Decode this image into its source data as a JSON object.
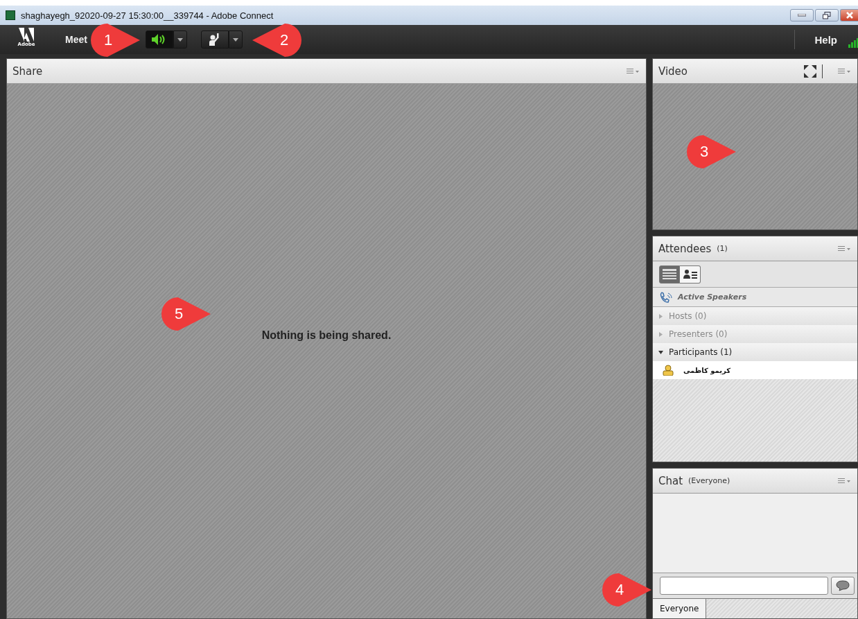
{
  "window": {
    "title": "shaghayegh_92020-09-27 15:30:00__339744 - Adobe Connect"
  },
  "menu_bar": {
    "logo": "Adobe",
    "menu": "Meet",
    "audio": {
      "on": true
    },
    "help": "Help"
  },
  "share_pod": {
    "title": "Share",
    "message": "Nothing is being shared."
  },
  "video_pod": {
    "title": "Video"
  },
  "attendees_pod": {
    "title": "Attendees",
    "count": "(1)",
    "views": [
      {
        "kind": "list",
        "selected": true
      },
      {
        "kind": "detail",
        "selected": false
      }
    ],
    "active_speakers": "Active Speakers",
    "groups": [
      {
        "label": "Hosts (0)",
        "expanded": false
      },
      {
        "label": "Presenters (0)",
        "expanded": false
      },
      {
        "label": "Participants (1)",
        "expanded": true,
        "children": [
          {
            "name": "کریمو کاظمی"
          }
        ]
      }
    ]
  },
  "chat_pod": {
    "title": "Chat",
    "audience": "(Everyone)",
    "tabs": [
      {
        "label": "Everyone",
        "selected": true
      }
    ]
  },
  "callouts": [
    {
      "number": "1"
    },
    {
      "number": "2"
    },
    {
      "number": "3"
    },
    {
      "number": "4"
    },
    {
      "number": "5"
    }
  ]
}
